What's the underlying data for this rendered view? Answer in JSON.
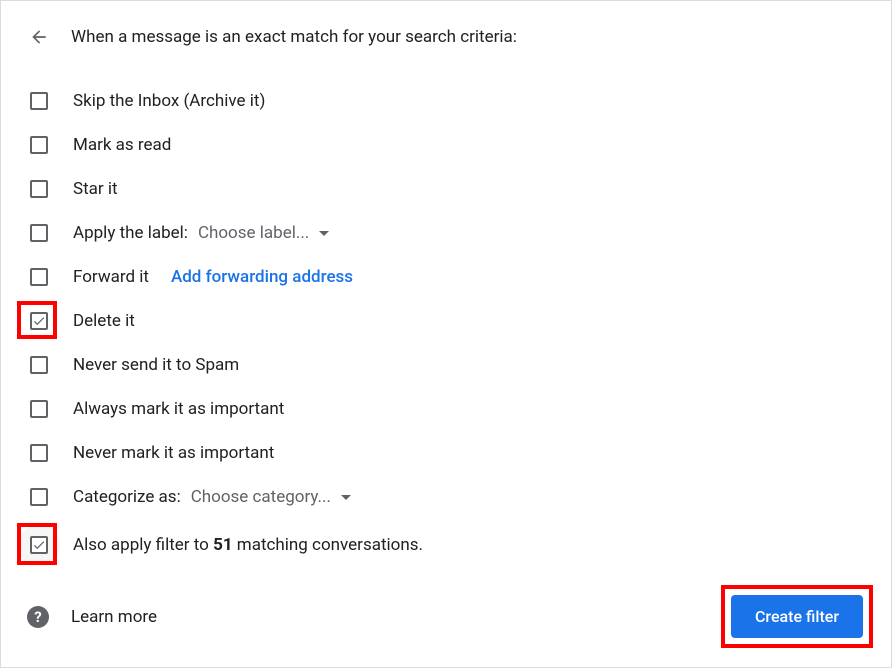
{
  "header": {
    "title": "When a message is an exact match for your search criteria:"
  },
  "options": {
    "skip_inbox": "Skip the Inbox (Archive it)",
    "mark_read": "Mark as read",
    "star_it": "Star it",
    "apply_label_prefix": "Apply the label:",
    "apply_label_dropdown": "Choose label...",
    "forward_it": "Forward it",
    "forward_link": "Add forwarding address",
    "delete_it": "Delete it",
    "never_spam": "Never send it to Spam",
    "always_important": "Always mark it as important",
    "never_important": "Never mark it as important",
    "categorize_prefix": "Categorize as:",
    "categorize_dropdown": "Choose category...",
    "also_apply_prefix": "Also apply filter to ",
    "also_apply_count": "51",
    "also_apply_suffix": " matching conversations."
  },
  "footer": {
    "learn_more": "Learn more",
    "create_button": "Create filter"
  },
  "checked": {
    "delete_it": true,
    "also_apply": true
  }
}
